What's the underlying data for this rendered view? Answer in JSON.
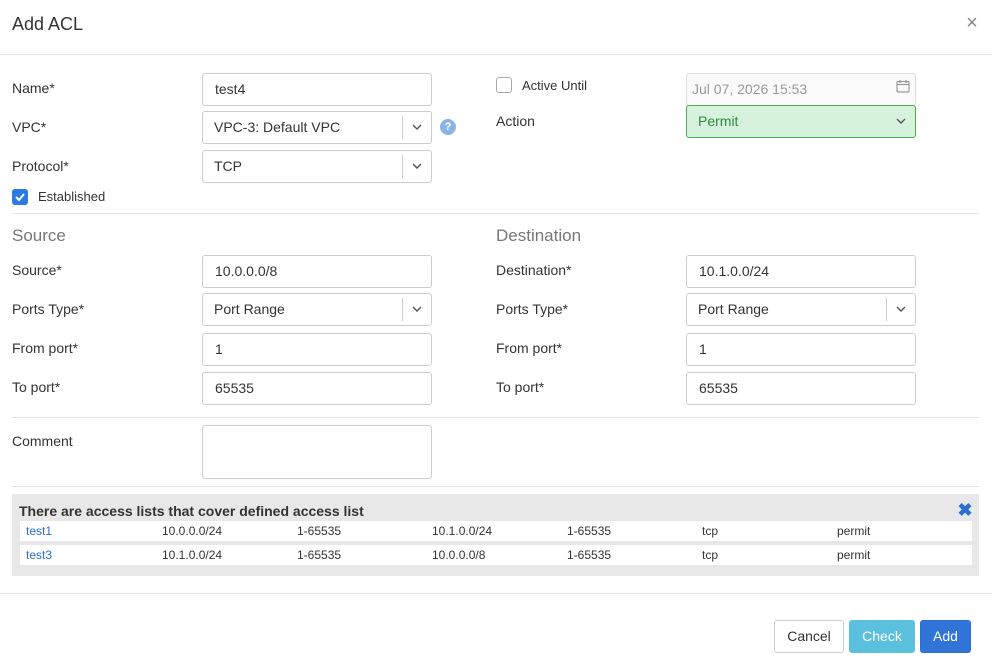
{
  "dialog": {
    "title": "Add ACL"
  },
  "form": {
    "name": {
      "label": "Name*",
      "value": "test4"
    },
    "vpc": {
      "label": "VPC*",
      "value": "VPC-3: Default VPC",
      "help": "?"
    },
    "protocol": {
      "label": "Protocol*",
      "value": "TCP"
    },
    "established": {
      "label": "Established",
      "checked": true
    },
    "active_until": {
      "label": "Active Until",
      "checked": false,
      "placeholder": "Jul 07, 2026 15:53"
    },
    "action": {
      "label": "Action",
      "value": "Permit",
      "color": "#2d8a3e"
    }
  },
  "source": {
    "heading": "Source",
    "address": {
      "label": "Source*",
      "value": "10.0.0.0/8"
    },
    "ports_type": {
      "label": "Ports Type*",
      "value": "Port Range"
    },
    "from_port": {
      "label": "From port*",
      "value": "1"
    },
    "to_port": {
      "label": "To port*",
      "value": "65535"
    }
  },
  "destination": {
    "heading": "Destination",
    "address": {
      "label": "Destination*",
      "value": "10.1.0.0/24"
    },
    "ports_type": {
      "label": "Ports Type*",
      "value": "Port Range"
    },
    "from_port": {
      "label": "From port*",
      "value": "1"
    },
    "to_port": {
      "label": "To port*",
      "value": "65535"
    }
  },
  "comment": {
    "label": "Comment",
    "value": ""
  },
  "coverage": {
    "title": "There are access lists that cover defined access list",
    "rows": [
      [
        "test1",
        "10.0.0.0/24",
        "1-65535",
        "10.1.0.0/24",
        "1-65535",
        "tcp",
        "permit"
      ],
      [
        "test3",
        "10.1.0.0/24",
        "1-65535",
        "10.0.0.0/8",
        "1-65535",
        "tcp",
        "permit"
      ]
    ]
  },
  "buttons": {
    "cancel": "Cancel",
    "check": "Check",
    "add": "Add"
  },
  "colors": {
    "primary": "#2f74d6",
    "info": "#5bc0de",
    "permit_bg": "#d7f2dc"
  }
}
